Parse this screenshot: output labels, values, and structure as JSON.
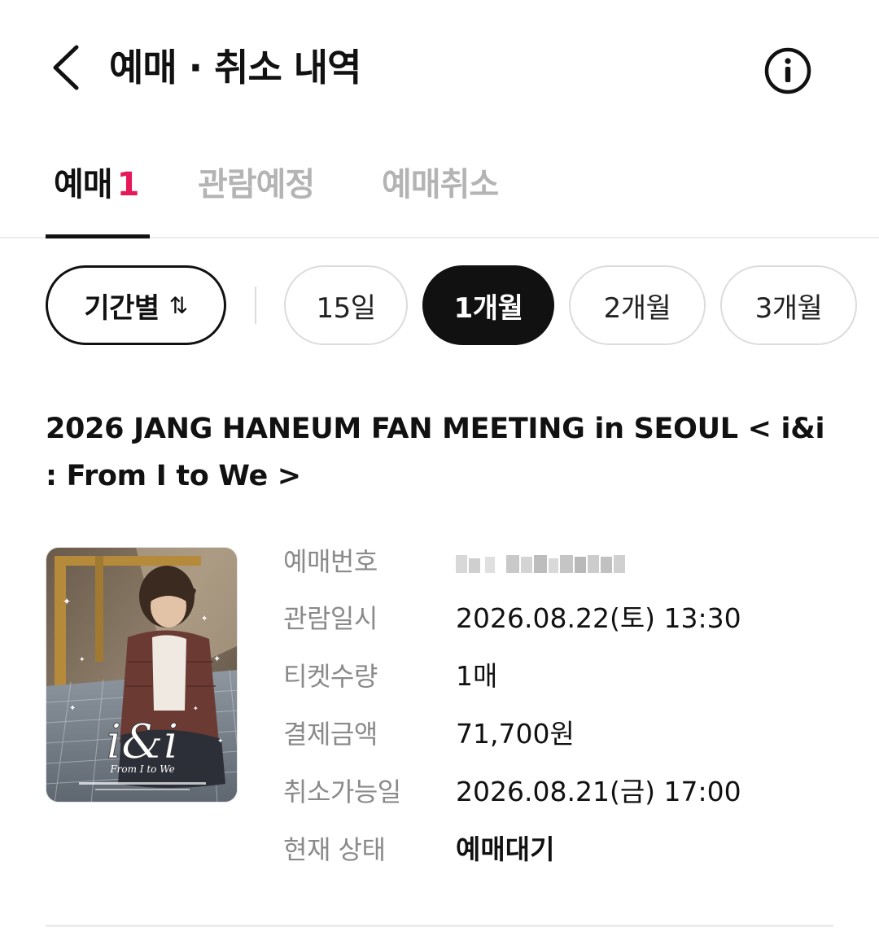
{
  "header": {
    "title": "예매 · 취소 내역",
    "back_icon": "chevron-left-icon",
    "info_icon": "info-icon"
  },
  "tabs": [
    {
      "label": "예매",
      "count": "1",
      "active": true
    },
    {
      "label": "관람예정",
      "active": false
    },
    {
      "label": "예매취소",
      "active": false
    }
  ],
  "filters": {
    "period_label": "기간별",
    "sort_icon": "⇅",
    "options": [
      "15일",
      "1개월",
      "2개월",
      "3개월"
    ],
    "selected": "1개월"
  },
  "booking": {
    "title": "2026 JANG HANEUM FAN MEETING in SEOUL < i&i : From I to We >",
    "poster": {
      "art_text": "i&i",
      "art_subtext": "From I to We"
    },
    "details": [
      {
        "label": "예매번호",
        "value": ""
      },
      {
        "label": "관람일시",
        "value": "2026.08.22(토) 13:30"
      },
      {
        "label": "티켓수량",
        "value": "1매"
      },
      {
        "label": "결제금액",
        "value": "71,700원"
      },
      {
        "label": "취소가능일",
        "value": "2026.08.21(금) 17:00"
      },
      {
        "label": "현재 상태",
        "value": "예매대기"
      }
    ]
  },
  "colors": {
    "accent": "#e5195a",
    "selected_chip": "#111111",
    "muted_text": "#8a8a8a",
    "inactive_tab": "#b4b4b4"
  }
}
